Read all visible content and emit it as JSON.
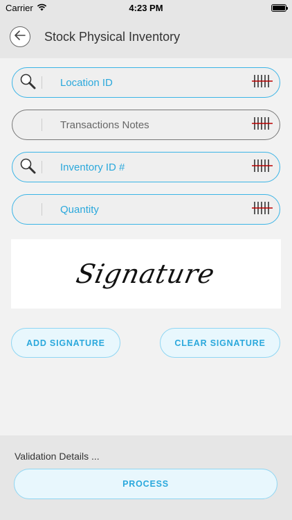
{
  "status_bar": {
    "carrier": "Carrier",
    "time": "4:23 PM",
    "icons": {
      "wifi": "wifi-icon",
      "battery": "battery-icon"
    }
  },
  "header": {
    "title": "Stock Physical Inventory",
    "back_icon": "back-arrow-icon"
  },
  "fields": [
    {
      "placeholder": "Location ID",
      "lead_icon": "search-icon",
      "trail_icon": "barcode-scan-icon",
      "border": "#3ab4e6"
    },
    {
      "placeholder": "Transactions Notes",
      "lead_icon": "",
      "trail_icon": "barcode-scan-icon",
      "border": "#777777"
    },
    {
      "placeholder": "Inventory ID #",
      "lead_icon": "search-icon",
      "trail_icon": "barcode-scan-icon",
      "border": "#3ab4e6"
    },
    {
      "placeholder": "Quantity",
      "lead_icon": "",
      "trail_icon": "barcode-scan-icon",
      "border": "#3ab4e6"
    }
  ],
  "signature": {
    "text": "Signature"
  },
  "buttons": {
    "add_signature": "ADD SIGNATURE",
    "clear_signature": "CLEAR SIGNATURE",
    "process": "PROCESS"
  },
  "footer": {
    "validation_text": "Validation Details ..."
  },
  "colors": {
    "accent": "#2aa8dc",
    "button_bg": "#e8f7fd",
    "panel_bg": "#e6e6e6",
    "page_bg": "#f2f2f2"
  }
}
